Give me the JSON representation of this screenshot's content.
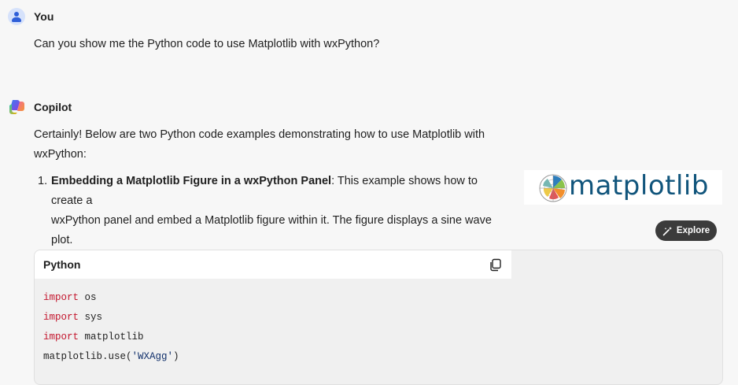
{
  "user": {
    "name": "You",
    "message": "Can you show me the Python code to use Matplotlib with wxPython?"
  },
  "assistant": {
    "name": "Copilot",
    "intro_line1": "Certainly! Below are two Python code examples demonstrating how to use Matplotlib with",
    "intro_line2": "wxPython:",
    "list": [
      {
        "number": "1.",
        "title": "Embedding a Matplotlib Figure in a wxPython Panel",
        "line1_rest": ": This example shows how to create a",
        "line2": "wxPython panel and embed a Matplotlib figure within it. The figure displays a sine wave",
        "line3": "plot."
      }
    ]
  },
  "image_card": {
    "logo_text": "matplotlib",
    "explore_label": "Explore",
    "icon": "magic-wand-icon"
  },
  "code_block": {
    "language": "Python",
    "copy_icon": "copy-icon",
    "lines": [
      {
        "kw": "import",
        "rest": " os"
      },
      {
        "kw": "import",
        "rest": " sys"
      },
      {
        "kw": "import",
        "rest": " matplotlib"
      },
      {
        "pre": "matplotlib.use(",
        "str": "'WXAgg'",
        "post": ")"
      }
    ]
  },
  "colors": {
    "user_avatar": "#d6e2fb",
    "keyword": "#c3172e",
    "string": "#11306b",
    "logo": "#11557c"
  }
}
